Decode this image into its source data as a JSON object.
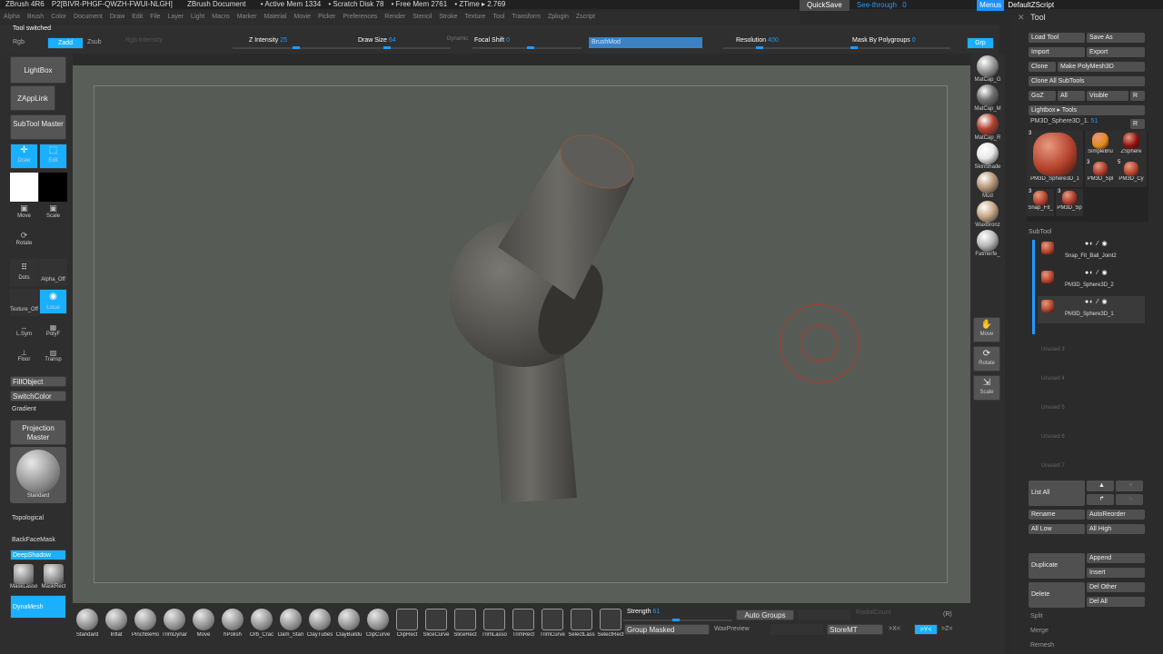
{
  "titlebar": {
    "app": "ZBrush 4R6",
    "serial": "P2[BIVR-PHGF-QWZH-FWUI-NLGH]",
    "doc": "ZBrush Document",
    "active_mem": "• Active Mem 1334",
    "scratch": "• Scratch Disk 78",
    "free_mem": "• Free Mem 2761",
    "ztime": "• ZTime ▸ 2.769"
  },
  "topright": {
    "quicksave": "QuickSave",
    "seethrough": "See-through",
    "seethrough_val": "0",
    "menus": "Menus",
    "script": "DefaultZScript"
  },
  "menu": [
    "Alpha",
    "Brush",
    "Color",
    "Document",
    "Draw",
    "Edit",
    "File",
    "Layer",
    "Light",
    "Macro",
    "Marker",
    "Material",
    "Movie",
    "Picker",
    "Preferences",
    "Render",
    "Stencil",
    "Stroke",
    "Texture",
    "Tool",
    "Transform",
    "Zplugin",
    "Zscript"
  ],
  "status": "Tool switched",
  "toolbar": {
    "rgb": "Rgb",
    "zadd": "Zadd",
    "zsub": "Zsub",
    "rgb_intensity": "Rgb Intensity",
    "z_intensity": "Z Intensity",
    "z_intensity_val": "25",
    "draw_size": "Draw Size",
    "draw_size_val": "64",
    "dynamic": "Dynamic",
    "focal_shift": "Focal Shift",
    "focal_shift_val": "0",
    "brushmod": "BrushMod",
    "resolution": "Resolution",
    "resolution_val": "400",
    "mask_polygroups": "Mask By Polygroups",
    "mask_polygroups_val": "0",
    "grp": "Grp"
  },
  "left": {
    "lightbox": "LightBox",
    "zapplink": "ZAppLink",
    "subtool_master": "SubTool Master",
    "draw": "Draw",
    "edit": "Edit",
    "move": "Move",
    "scale": "Scale",
    "rotate": "Rotate",
    "dots": "Dots",
    "alpha_off": "Alpha_Off",
    "texture_off": "Texture_Off",
    "local": "Local",
    "lsym": "L.Sym",
    "polyf": "PolyF",
    "floor": "Floor",
    "transp": "Transp",
    "fillobject": "FillObject",
    "switchcolor": "SwitchColor",
    "gradient": "Gradient",
    "projection_master": "Projection Master",
    "standard": "Standard",
    "topological": "Topological",
    "backfacemask": "BackFaceMask",
    "deepshadow": "DeepShadow",
    "masklasso": "MaskLasso",
    "maskrect": "MaskRect",
    "dynamesh": "DynaMesh"
  },
  "matcaps": [
    {
      "label": "MatCap_G",
      "color": "#9a9a9a"
    },
    {
      "label": "MatCap_M",
      "color": "#6e6e6e"
    },
    {
      "label": "MatCap_R",
      "color": "#b0402e"
    },
    {
      "label": "SkinShade",
      "color": "#e8e8e8"
    },
    {
      "label": "Mud",
      "color": "#b89878"
    },
    {
      "label": "WaxBronz",
      "color": "#c8a888"
    },
    {
      "label": "Fatmerfe_",
      "color": "#bbbbbb"
    }
  ],
  "viewtools": {
    "move": "Move",
    "rotate": "Rotate",
    "scale": "Scale"
  },
  "tool": {
    "title": "Tool",
    "load": "Load Tool",
    "save": "Save As",
    "import": "Import",
    "export": "Export",
    "clone": "Clone",
    "make_poly": "Make PolyMesh3D",
    "clone_all": "Clone All SubTools",
    "goz": "GoZ",
    "all": "All",
    "visible": "Visible",
    "r": "R",
    "lightbox_tools": "Lightbox ▸ Tools",
    "current": "PM3D_Sphere3D_1.",
    "current_val": "51",
    "thumbs": [
      {
        "label": "PM3D_Sphere3D_1",
        "count": "3"
      },
      {
        "label": "SimpleBru",
        "count": ""
      },
      {
        "label": "ZSphere",
        "count": ""
      },
      {
        "label": "PM3D_Spl",
        "count": "3"
      },
      {
        "label": "PM3D_Cy",
        "count": "5"
      },
      {
        "label": "Snap_Fit_",
        "count": "3"
      },
      {
        "label": "PM3D_Sp",
        "count": "3"
      }
    ],
    "subtool_title": "SubTool",
    "subtools": [
      "Snap_Fit_Ball_Joint2",
      "PM3D_Sphere3D_2",
      "PM3D_Sphere3D_1"
    ],
    "unused": [
      "Unused 3",
      "Unused 4",
      "Unused 5",
      "Unused 6",
      "Unused 7"
    ],
    "list_all": "List All",
    "rename": "Rename",
    "autoreorder": "AutoReorder",
    "all_low": "All Low",
    "all_high": "All High",
    "duplicate": "Duplicate",
    "append": "Append",
    "insert": "Insert",
    "delete": "Delete",
    "del_other": "Del Other",
    "del_all": "Del All",
    "split": "Split",
    "merge": "Merge",
    "remesh": "Remesh"
  },
  "bottom": {
    "brushes": [
      "Standard",
      "Inflat",
      "PinchBeHo",
      "TrimDynar",
      "Move",
      "hPolish",
      "Orb_Crac",
      "Dam_Stan",
      "ClayTubes",
      "ClayBuildu",
      "ClipCurve",
      "ClipRect",
      "SliceCurve",
      "SliceRect",
      "TrimLasso",
      "TrimRect",
      "TrimCurve",
      "SelectLass",
      "SelectRect"
    ],
    "strength": "Strength",
    "strength_val": "61",
    "auto_groups": "Auto Groups",
    "group_masked": "Group Masked",
    "waxpreview": "WaxPreview",
    "storemt": "StoreMT",
    "radialcount": "RadialCount",
    "r": "(R)",
    "xsym": ">X<",
    "ysym": ">Y<",
    "zsym": ">Z<"
  }
}
